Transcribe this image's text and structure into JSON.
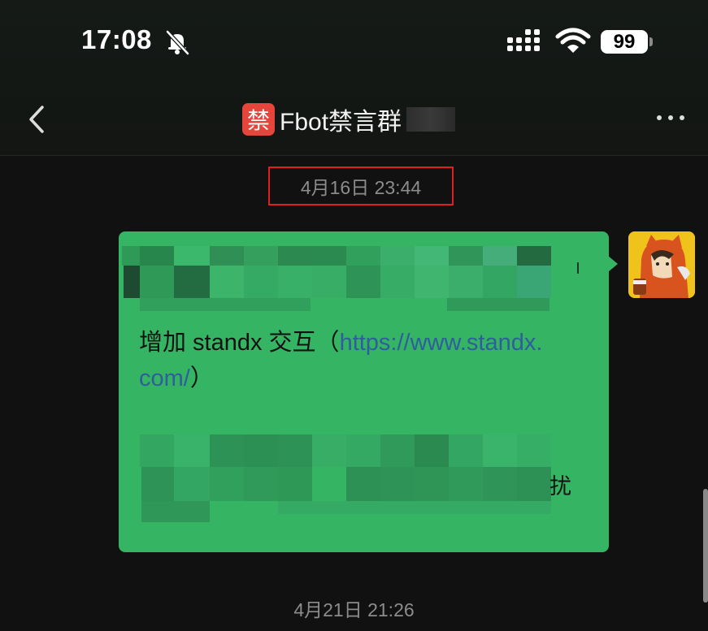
{
  "status_bar": {
    "time": "17:08",
    "battery": "99"
  },
  "header": {
    "title_badge": "禁",
    "title": "Fbot禁言群"
  },
  "messages": {
    "timestamp_1": "4月16日 23:44",
    "bubble": {
      "line_text": "增加 standx 交互（",
      "link_part1": "https://www.standx.",
      "link_part2": "com/",
      "line_end": "）",
      "trail_char": "扰"
    },
    "timestamp_2": "4月21日 21:26"
  },
  "colors": {
    "bubble": "#35b463",
    "highlight_border": "#e02020",
    "link": "#2e5e9c"
  }
}
